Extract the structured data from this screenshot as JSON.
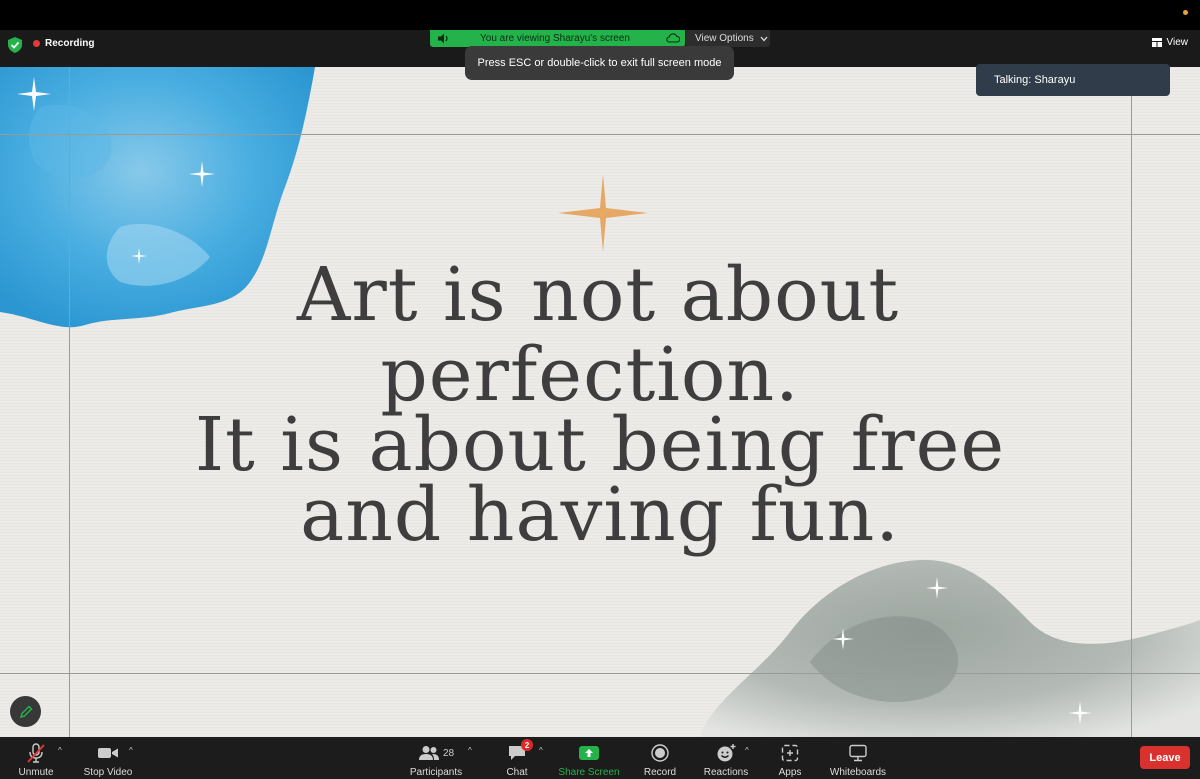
{
  "meeting": {
    "recording_label": "Recording",
    "viewing_label": "You are viewing Sharayu's screen",
    "view_options_label": "View Options",
    "view_label": "View",
    "esc_hint": "Press ESC or double-click to exit full screen mode",
    "talking_label": "Talking: Sharayu"
  },
  "slide": {
    "lines": [
      "Art is not about",
      "perfection.",
      "It is about being free",
      "and having fun."
    ]
  },
  "toolbar": {
    "unmute": "Unmute",
    "stop_video": "Stop Video",
    "participants": "Participants",
    "participants_count": "28",
    "chat": "Chat",
    "chat_badge": "2",
    "share_screen": "Share Screen",
    "record": "Record",
    "reactions": "Reactions",
    "apps": "Apps",
    "whiteboards": "Whiteboards",
    "leave": "Leave"
  },
  "colors": {
    "share_green": "#23b34a",
    "leave_red": "#d9322e",
    "star_gold": "#e5a865",
    "watercolor_blue": "#3aa8e0"
  }
}
